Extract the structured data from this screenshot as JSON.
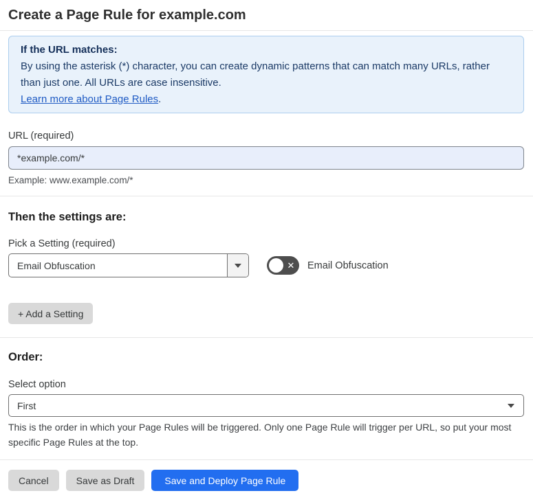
{
  "page": {
    "title": "Create a Page Rule for example.com"
  },
  "info_box": {
    "heading": "If the URL matches:",
    "body": "By using the asterisk (*) character, you can create dynamic patterns that can match many URLs, rather than just one. All URLs are case insensitive.",
    "link_label": "Learn more about Page Rules",
    "link_suffix": "."
  },
  "url_field": {
    "label": "URL (required)",
    "value": "*example.com/*",
    "helper": "Example: www.example.com/*"
  },
  "settings_section": {
    "heading": "Then the settings are:",
    "setting_label": "Pick a Setting (required)",
    "setting_value": "Email Obfuscation",
    "toggle_label": "Email Obfuscation",
    "toggle_state": "off",
    "add_button_label": "+ Add a Setting"
  },
  "order_section": {
    "heading": "Order:",
    "select_label": "Select option",
    "select_value": "First",
    "helper": "This is the order in which your Page Rules will be triggered. Only one Page Rule will trigger per URL, so put your most specific Page Rules at the top."
  },
  "footer": {
    "cancel_label": "Cancel",
    "save_draft_label": "Save as Draft",
    "deploy_label": "Save and Deploy Page Rule"
  },
  "icons": {
    "toggle_x": "✕"
  },
  "colors": {
    "info_box_bg": "#e9f2fb",
    "info_box_border": "#abcdee",
    "info_text": "#1b3a66",
    "link_blue": "#1f5bc4",
    "input_bg": "#e8eefb",
    "primary_button_blue": "#226ef0",
    "gray_button_bg": "#d9d9d9",
    "toggle_off_bg": "#4d4d4d"
  }
}
